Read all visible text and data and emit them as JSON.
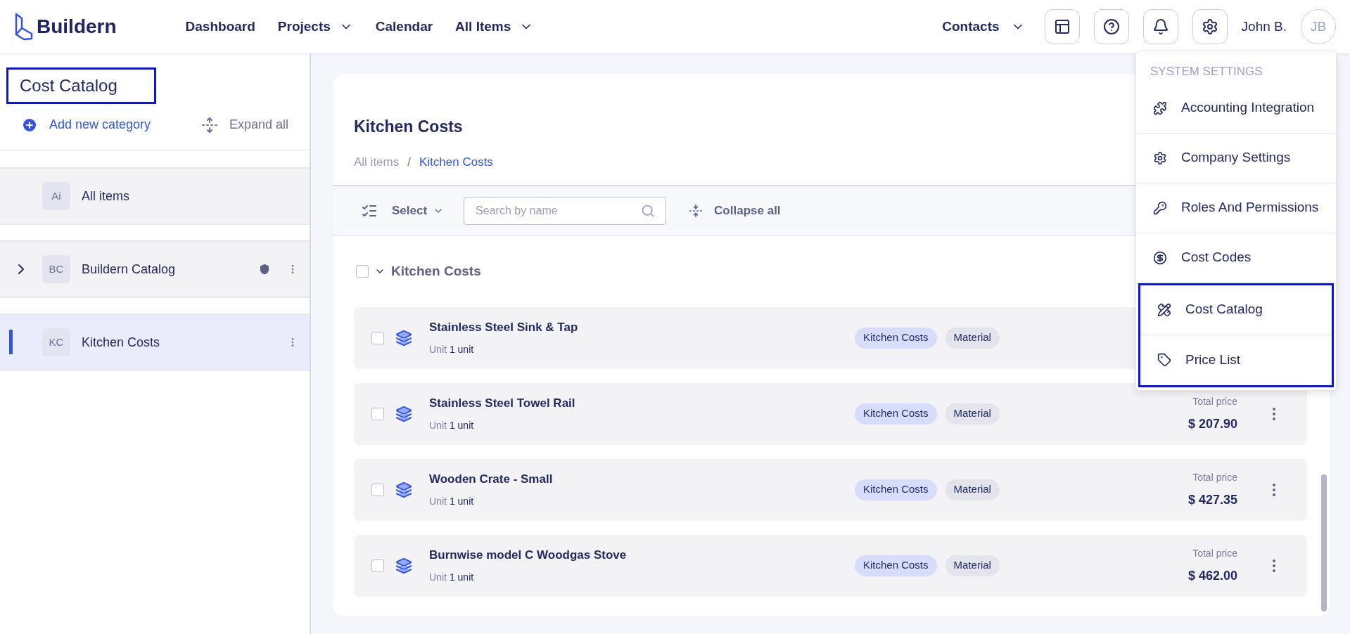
{
  "brand": {
    "name": "Buildern"
  },
  "nav": {
    "items": [
      {
        "label": "Dashboard",
        "dropdown": false
      },
      {
        "label": "Projects",
        "dropdown": true
      },
      {
        "label": "Calendar",
        "dropdown": false
      },
      {
        "label": "All Items",
        "dropdown": true
      }
    ],
    "contacts": {
      "label": "Contacts",
      "dropdown": true
    },
    "user": {
      "name": "John B.",
      "initials": "JB"
    }
  },
  "sidebar": {
    "title": "Cost Catalog",
    "title_highlighted": true,
    "add_label": "Add new category",
    "expand_label": "Expand all",
    "items": [
      {
        "initials": "Ai",
        "label": "All items",
        "selected": false,
        "expandable": false,
        "protected": false,
        "menu": false
      },
      {
        "initials": "BC",
        "label": "Buildern Catalog",
        "selected": false,
        "expandable": true,
        "protected": true,
        "menu": true
      },
      {
        "initials": "KC",
        "label": "Kitchen Costs",
        "selected": true,
        "expandable": false,
        "protected": false,
        "menu": true
      }
    ]
  },
  "content": {
    "title": "Kitchen Costs",
    "breadcrumb_separator": "/",
    "breadcrumb": [
      {
        "label": "All items",
        "current": false
      },
      {
        "label": "Kitchen Costs",
        "current": true
      }
    ],
    "toolbar": {
      "select_label": "Select",
      "search_placeholder": "Search by name",
      "collapse_label": "Collapse all"
    },
    "group": {
      "label": "Kitchen Costs",
      "checked": false,
      "expanded": true
    },
    "rows": [
      {
        "name": "Stainless Steel Sink & Tap",
        "unit_label": "Unit",
        "unit": "1 unit",
        "tags": [
          "Kitchen Costs",
          "Material"
        ],
        "checked": false
      },
      {
        "name": "Stainless Steel Towel Rail",
        "unit_label": "Unit",
        "unit": "1 unit",
        "tags": [
          "Kitchen Costs",
          "Material"
        ],
        "checked": false,
        "price_label": "Total price",
        "price": "$ 207.90"
      },
      {
        "name": "Wooden Crate - Small",
        "unit_label": "Unit",
        "unit": "1 unit",
        "tags": [
          "Kitchen Costs",
          "Material"
        ],
        "checked": false,
        "price_label": "Total price",
        "price": "$ 427.35"
      },
      {
        "name": "Burnwise model C Woodgas Stove",
        "unit_label": "Unit",
        "unit": "1 unit",
        "tags": [
          "Kitchen Costs",
          "Material"
        ],
        "checked": false,
        "price_label": "Total price",
        "price": "$ 462.00"
      }
    ]
  },
  "settings_menu": {
    "heading": "SYSTEM SETTINGS",
    "items": [
      {
        "kind": "puzzle",
        "label": "Accounting Integration",
        "highlighted": false
      },
      {
        "kind": "gear",
        "label": "Company Settings",
        "highlighted": false
      },
      {
        "kind": "roles",
        "label": "Roles And Permissions",
        "highlighted": false
      },
      {
        "kind": "dollar",
        "label": "Cost Codes",
        "highlighted": false
      },
      {
        "kind": "catalog",
        "label": "Cost Catalog",
        "highlighted": true
      },
      {
        "kind": "tag",
        "label": "Price List",
        "highlighted": true
      }
    ]
  }
}
